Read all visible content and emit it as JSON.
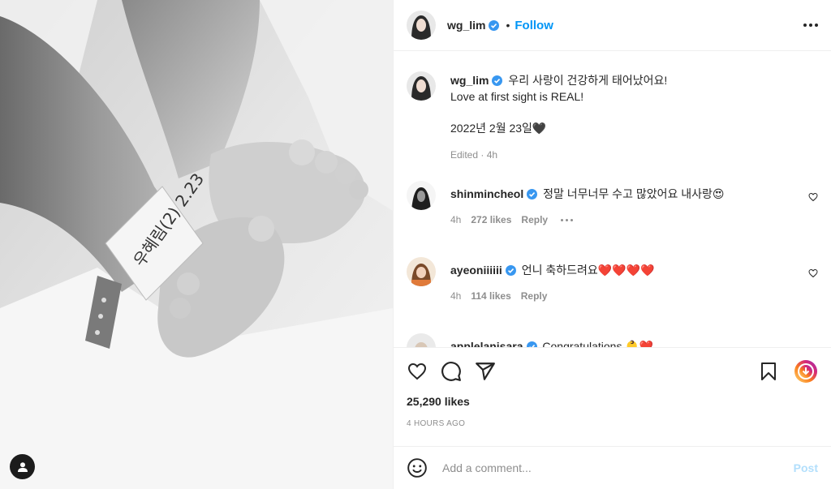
{
  "post": {
    "author": "wg_lim",
    "follow_label": "Follow",
    "separator": "•",
    "caption_line1": "우리 사랑이 건강하게 태어났어요!",
    "caption_line2": "Love at first sight is REAL!",
    "caption_date": "2022년 2월 23일🖤",
    "caption_meta": "Edited · 4h",
    "bracelet_text": "우혜림(2) 2.23"
  },
  "comments": [
    {
      "user": "shinmincheol",
      "text": "정말 너무너무 수고 많았어요 내사랑😍",
      "time": "4h",
      "likes": "272 likes",
      "reply": "Reply"
    },
    {
      "user": "ayeoniiiiii",
      "text": "언니 축하드려요❤️❤️❤️❤️",
      "time": "4h",
      "likes": "114 likes",
      "reply": "Reply"
    },
    {
      "user": "applelanisara",
      "text": "Congratulations 👶❤️"
    }
  ],
  "engagement": {
    "likes": "25,290 likes",
    "time_ago": "4 HOURS AGO"
  },
  "add_comment": {
    "placeholder": "Add a comment...",
    "post_label": "Post"
  },
  "icons": {
    "like": "heart-icon",
    "comment": "comment-icon",
    "share": "share-icon",
    "save": "bookmark-icon",
    "emoji": "emoji-icon",
    "more": "more-icon",
    "verified": "verified-badge-icon",
    "tag": "tagged-user-icon",
    "promo": "instagram-gradient-icon"
  },
  "colors": {
    "accent": "#0095f6",
    "verified": "#3897f0",
    "post_disabled": "#b2dffc",
    "muted": "#8e8e8e"
  }
}
